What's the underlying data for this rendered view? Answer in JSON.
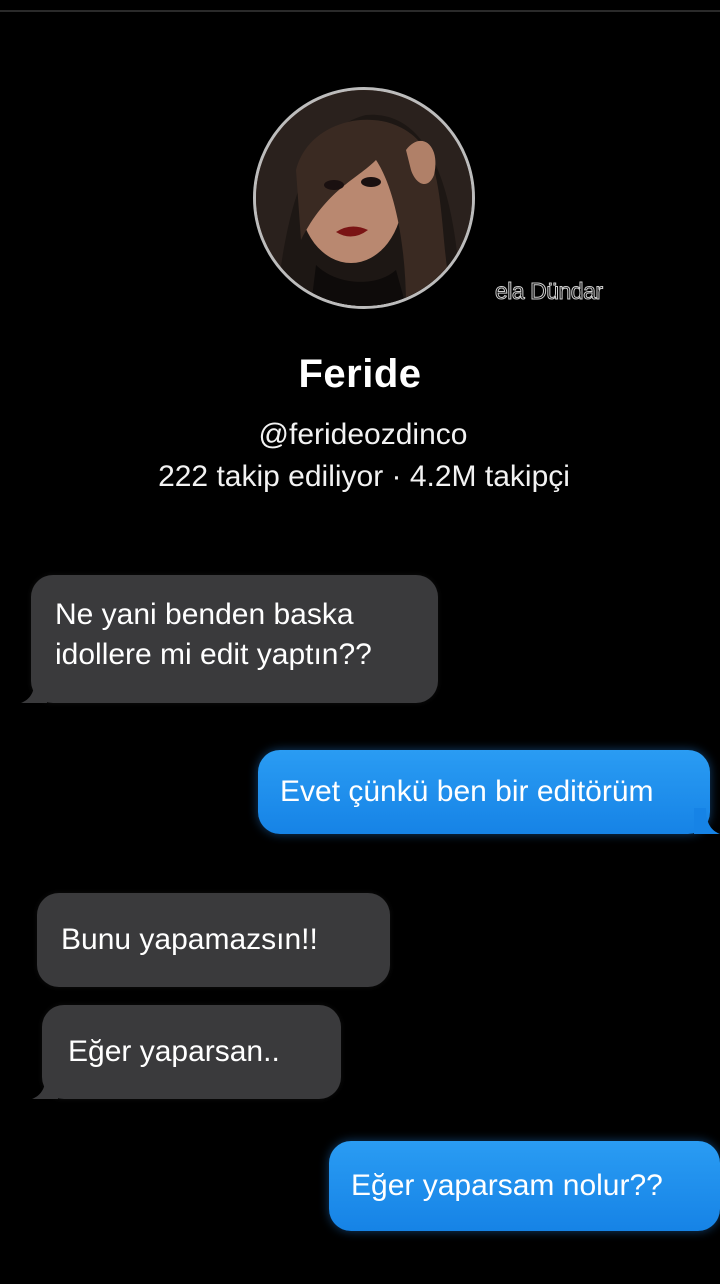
{
  "profile": {
    "name": "Feride",
    "handle": "@ferideozdinco",
    "stats": "222 takip ediliyor · 4.2M takipçi",
    "watermark": "ela Dündar"
  },
  "messages": [
    {
      "direction": "incoming",
      "text": "Ne yani benden baska idollere mi edit yaptın??"
    },
    {
      "direction": "outgoing",
      "text": "Evet çünkü ben bir editörüm"
    },
    {
      "direction": "incoming",
      "text": "Bunu yapamazsın!!"
    },
    {
      "direction": "incoming",
      "text": "Eğer yaparsan.."
    },
    {
      "direction": "outgoing",
      "text": "Eğer yaparsam nolur??"
    }
  ],
  "colors": {
    "background": "#000000",
    "incoming_bubble": "#3a3a3c",
    "outgoing_bubble": "#1e8ff0"
  }
}
